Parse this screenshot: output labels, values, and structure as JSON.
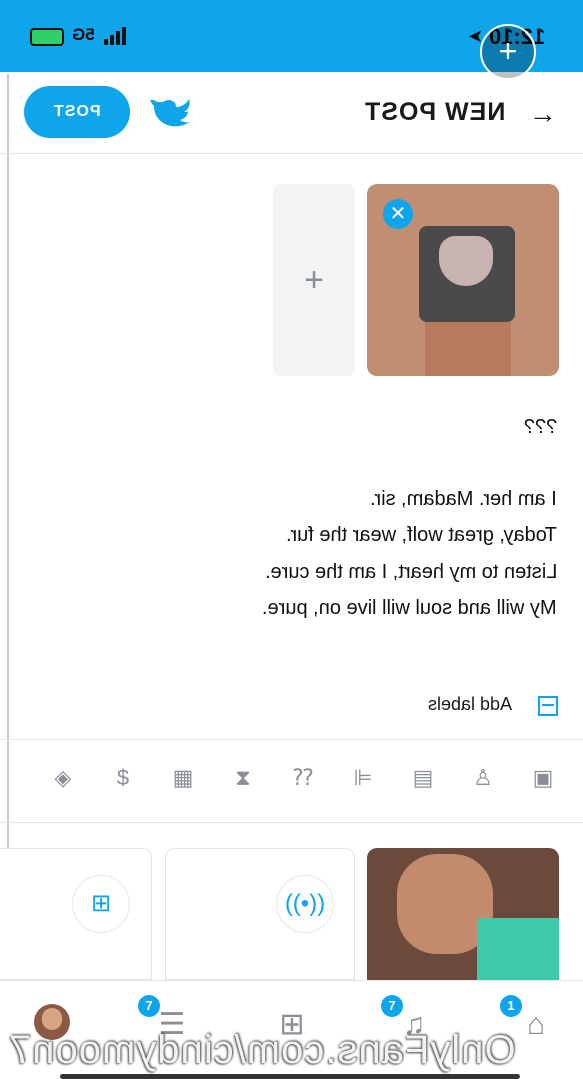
{
  "status_bar": {
    "time": "12:10",
    "network": "5G",
    "background_color": "#0fa5ea"
  },
  "header": {
    "title": "NEW POST",
    "post_button_label": "POST"
  },
  "composer": {
    "add_media_symbol": "+",
    "remove_media_symbol": "✕",
    "lines": [
      "???",
      "I am her. Madam, sir.",
      "Today, great wolf, wear the fur.",
      "Listen to my heart, I am the cure.",
      "My will and soul will live on, pure."
    ],
    "add_labels": "Add labels"
  },
  "toolbar": {
    "icons": [
      "image-icon",
      "microphone-icon",
      "vault-icon",
      "poll-icon",
      "question-icon",
      "timer-icon",
      "schedule-icon",
      "price-icon",
      "tag-icon"
    ]
  },
  "tray": {
    "add_symbol": "+"
  },
  "bottom_nav": {
    "home_badge": "1",
    "notifications_badge": "7",
    "messages_badge": "7"
  },
  "watermark": "OnlyFans.com/cindymoon7",
  "colors": {
    "accent": "#0fa5ea",
    "icon_gray": "#8a8f96"
  }
}
